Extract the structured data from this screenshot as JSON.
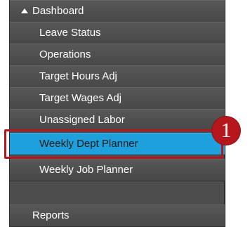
{
  "menu": {
    "items": [
      {
        "label": "Dashboard",
        "level": "parent",
        "expanded": true
      },
      {
        "label": "Leave Status",
        "level": "child"
      },
      {
        "label": "Operations",
        "level": "child"
      },
      {
        "label": "Target Hours Adj",
        "level": "child"
      },
      {
        "label": "Target Wages Adj",
        "level": "child"
      },
      {
        "label": "Unassigned Labor",
        "level": "child"
      },
      {
        "label": "Weekly Dept Planner",
        "level": "child",
        "selected": true
      },
      {
        "label": "Weekly Job Planner",
        "level": "child"
      },
      {
        "label": "Reports",
        "level": "parent"
      }
    ]
  },
  "callout": {
    "number": "1"
  },
  "colors": {
    "menu_background": "#4d4d4d",
    "selected_background": "#1ea0dc",
    "highlight": "#b3161b"
  }
}
